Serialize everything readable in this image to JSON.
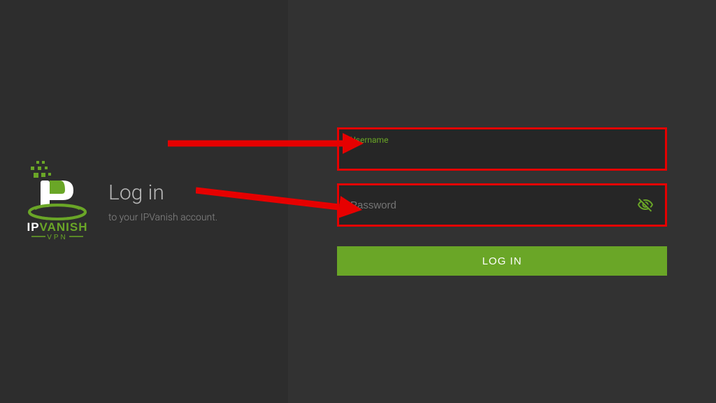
{
  "brand": {
    "name_part1": "IP",
    "name_part2": "VANISH",
    "tagline": "VPN"
  },
  "heading": {
    "title": "Log in",
    "subtitle": "to your IPVanish account."
  },
  "form": {
    "username_label": "Username",
    "password_placeholder": "Password",
    "login_button": "LOG IN"
  },
  "colors": {
    "accent_green": "#6aa627",
    "annotation_red": "#e60000"
  }
}
